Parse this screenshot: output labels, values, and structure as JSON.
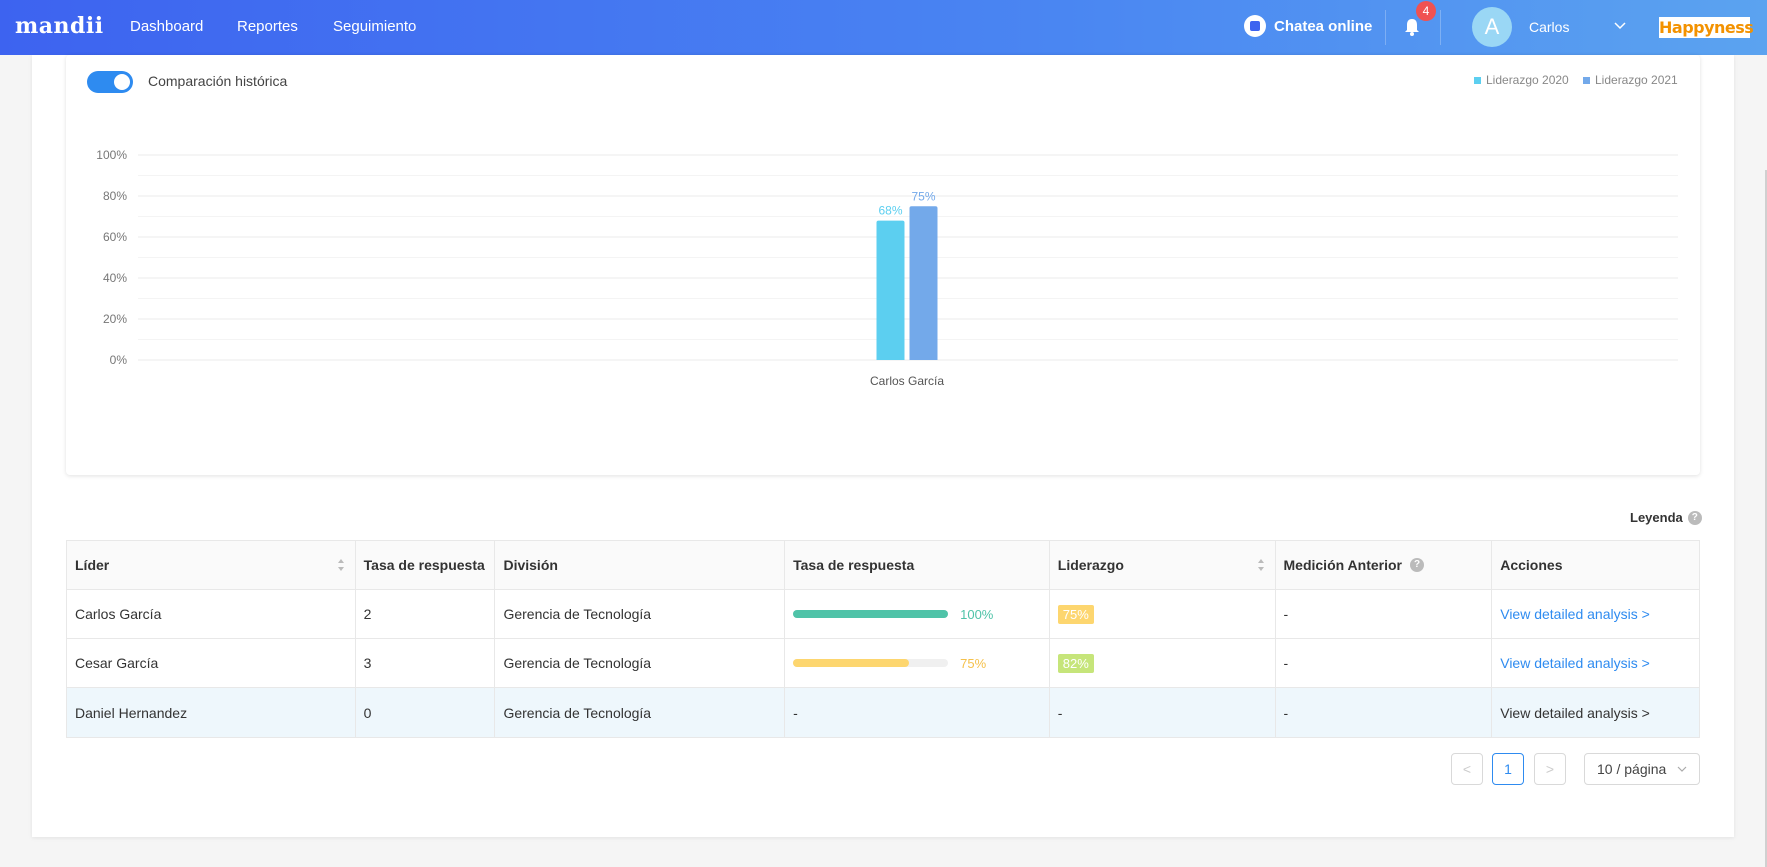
{
  "nav": {
    "logo": "mandii",
    "links": [
      "Dashboard",
      "Reportes",
      "Seguimiento"
    ],
    "chat": "Chatea online",
    "notifications": "4",
    "avatar_letter": "A",
    "user": "Carlos",
    "brand": "Happyness"
  },
  "chart_controls": {
    "toggle_label": "Comparación histórica",
    "toggle_on": true
  },
  "chart_data": {
    "type": "bar",
    "categories": [
      "Carlos García"
    ],
    "series": [
      {
        "name": "Liderazgo 2020",
        "values": [
          68
        ],
        "color": "#5ccff0"
      },
      {
        "name": "Liderazgo 2021",
        "values": [
          75
        ],
        "color": "#73a9ea"
      }
    ],
    "data_labels": [
      "68%",
      "75%"
    ],
    "yticks": [
      "100%",
      "80%",
      "60%",
      "40%",
      "20%",
      "0%"
    ],
    "ylim": [
      0,
      100
    ],
    "grid": true,
    "legend": "top-right"
  },
  "legend_label": "Leyenda",
  "table": {
    "headers": [
      "Líder",
      "Tasa de respuesta",
      "División",
      "Tasa de respuesta",
      "Liderazgo",
      "Medición Anterior",
      "Acciones"
    ],
    "rows": [
      {
        "lider": "Carlos García",
        "tasa": "2",
        "division": "Gerencia de Tecnología",
        "progress_pct": "100%",
        "progress": 1.0,
        "progress_color": "#4fc3a8",
        "liderazgo": "75%",
        "liderazgo_color": "#fdd66f",
        "anterior": "-",
        "accion": "View detailed analysis >"
      },
      {
        "lider": "Cesar García",
        "tasa": "3",
        "division": "Gerencia de Tecnología",
        "progress_pct": "75%",
        "progress": 0.75,
        "progress_color": "#fdd66f",
        "liderazgo": "82%",
        "liderazgo_color": "#c6e57a",
        "anterior": "-",
        "accion": "View detailed analysis >"
      },
      {
        "lider": "Daniel Hernandez",
        "tasa": "0",
        "division": "Gerencia de Tecnología",
        "progress_pct": "-",
        "liderazgo": "-",
        "anterior": "-",
        "accion": "View detailed analysis >"
      }
    ]
  },
  "pagination": {
    "prev": "<",
    "current": "1",
    "next": ">",
    "page_size": "10 / página"
  }
}
